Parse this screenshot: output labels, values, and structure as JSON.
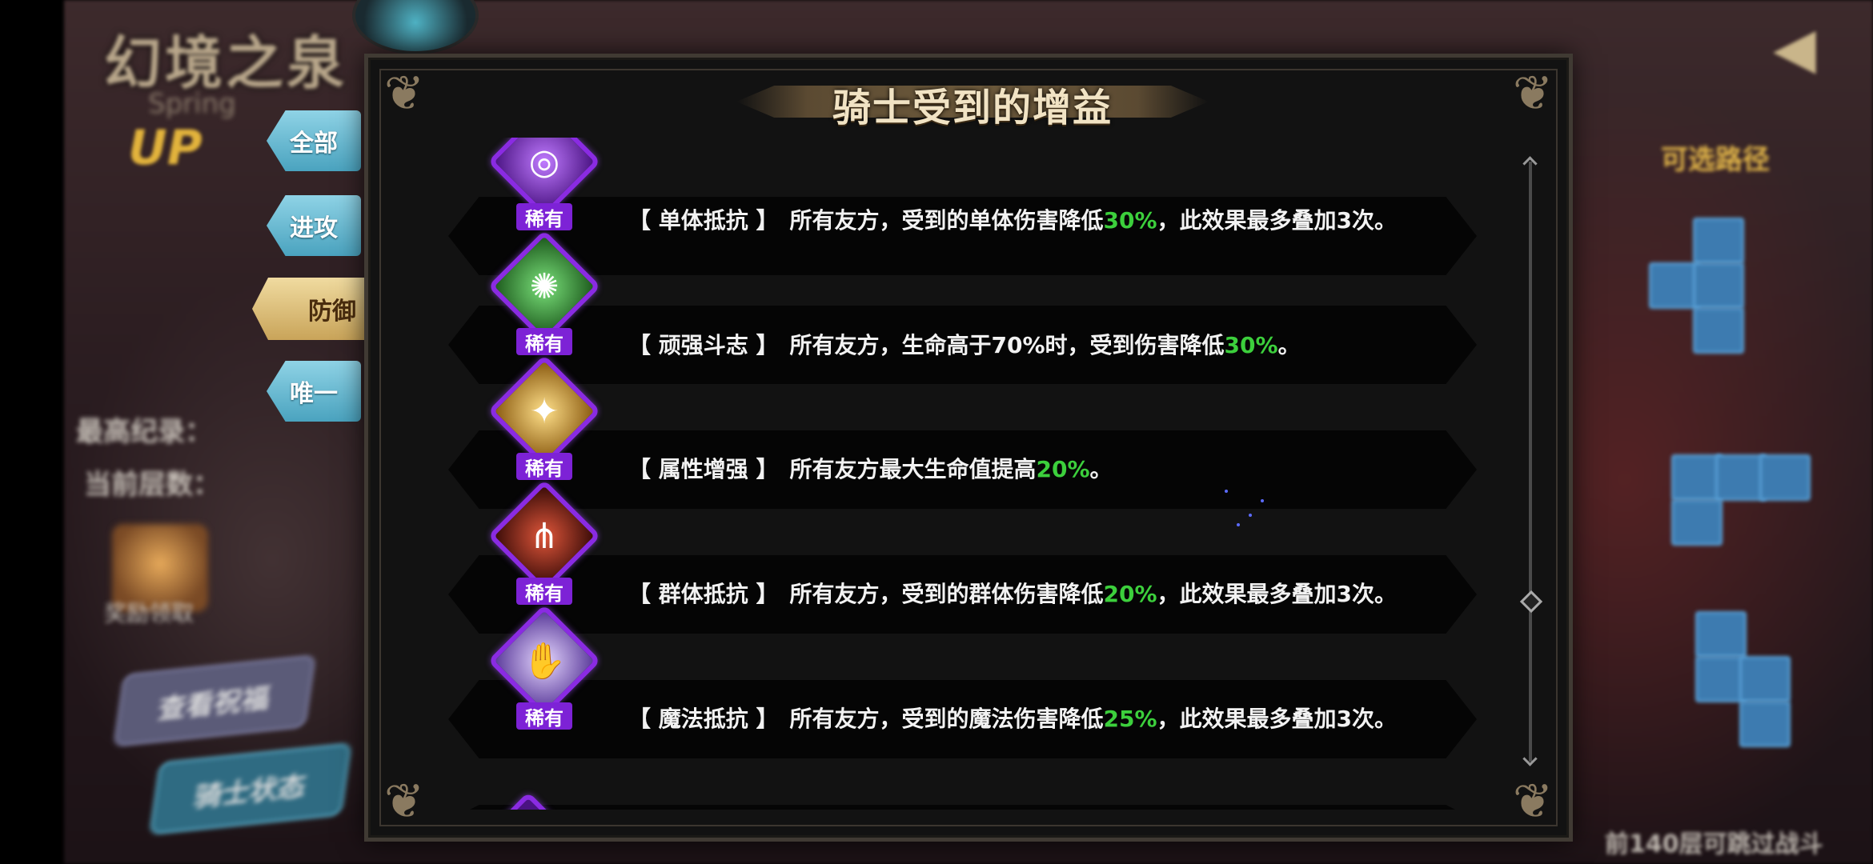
{
  "background": {
    "game_title": "幻境之泉",
    "game_title_sub": "Spring",
    "up_badge": "UP",
    "record_high_label": "最高纪录：",
    "record_current_label": "当前层数：",
    "chest_label": "奖励领取",
    "view_button": "查看祝福",
    "knight_state_button": "骑士状态",
    "right_panel_title": "可选路径",
    "bottom_note": "前140层可跳过战斗"
  },
  "filter_tabs": [
    {
      "label": "全部",
      "active": false
    },
    {
      "label": "进攻",
      "active": false
    },
    {
      "label": "防御",
      "active": true
    },
    {
      "label": "唯一",
      "active": false
    }
  ],
  "modal": {
    "title": "骑士受到的增益",
    "buffs": [
      {
        "name": "【 单体抵抗 】",
        "desc_before": "所有友方，受到的单体伤害降低",
        "value": "30%",
        "desc_after": "，此效果最多叠加3次。",
        "rarity": "稀有",
        "icon": "purple-swirl-icon"
      },
      {
        "name": "【 顽强斗志 】",
        "desc_before": "所有友方，生命高于70%时，受到伤害降低",
        "value": "30%",
        "desc_after": "。",
        "rarity": "稀有",
        "icon": "green-vortex-icon"
      },
      {
        "name": "【 属性增强 】",
        "desc_before": "所有友方最大生命值提高",
        "value": "20%",
        "desc_after": "。",
        "rarity": "稀有",
        "icon": "gold-star-icon"
      },
      {
        "name": "【 群体抵抗 】",
        "desc_before": "所有友方，受到的群体伤害降低",
        "value": "20%",
        "desc_after": "，此效果最多叠加3次。",
        "rarity": "稀有",
        "icon": "red-claw-icon"
      },
      {
        "name": "【 魔法抵抗 】",
        "desc_before": "所有友方，受到的魔法伤害降低",
        "value": "25%",
        "desc_after": "，此效果最多叠加3次。",
        "rarity": "稀有",
        "icon": "magic-hand-icon"
      }
    ]
  },
  "colors": {
    "highlight_green": "#3ccf3c",
    "rarity_purple": "#7d22d6",
    "tab_blue": "#4aa3bf",
    "tab_active_gold": "#c9a459"
  }
}
